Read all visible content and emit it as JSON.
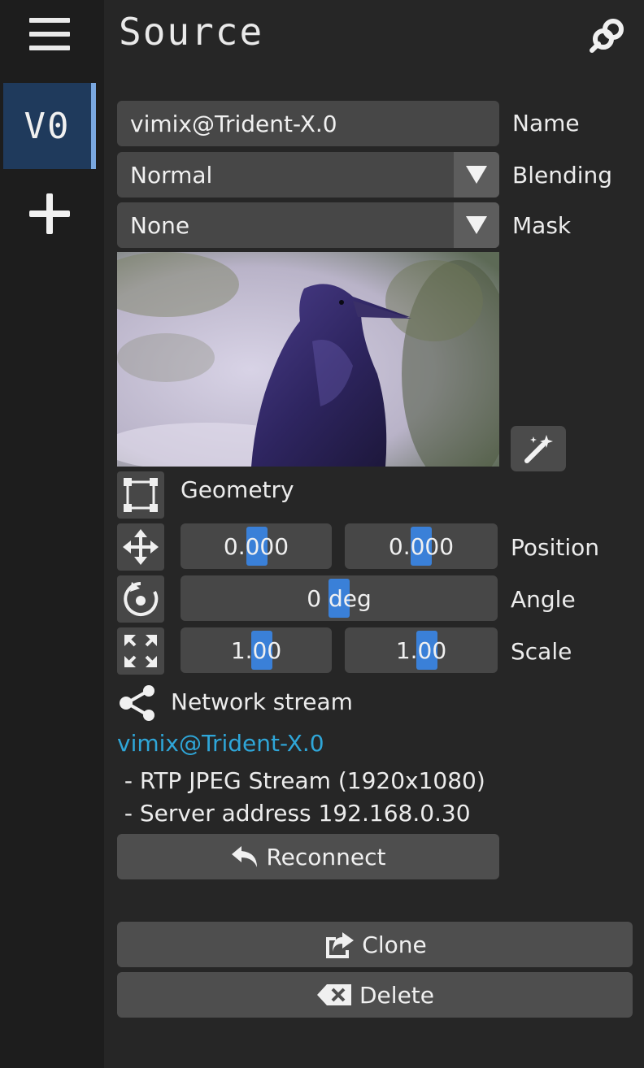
{
  "sidebar": {
    "view_label": "V0"
  },
  "header": {
    "title": "Source"
  },
  "name_field": {
    "value": "vimix@Trident-X.0",
    "label": "Name"
  },
  "blending": {
    "value": "Normal",
    "label": "Blending"
  },
  "mask": {
    "value": "None",
    "label": "Mask"
  },
  "geometry": {
    "label": "Geometry",
    "position": {
      "x": "0.000",
      "y": "0.000",
      "label": "Position"
    },
    "angle": {
      "value": "0 deg",
      "label": "Angle"
    },
    "scale": {
      "x": "1.00",
      "y": "1.00",
      "label": "Scale"
    }
  },
  "stream": {
    "section_label": "Network stream",
    "source_name": "vimix@Trident-X.0",
    "line1": " - RTP JPEG Stream (1920x1080)",
    "line2": " - Server address 192.168.0.30",
    "reconnect_label": "Reconnect"
  },
  "actions": {
    "clone_label": "Clone",
    "delete_label": "Delete"
  },
  "colors": {
    "accent": "#3a80d8",
    "link": "#2fa6d8",
    "background": "#262626",
    "selected": "#1f3a5c"
  },
  "icons": [
    "menu-icon",
    "plus-icon",
    "link-icon",
    "magic-wand-icon",
    "geometry-icon",
    "move-icon",
    "rotate-icon",
    "scale-icon",
    "share-icon",
    "undo-arrow-icon",
    "clone-icon",
    "delete-icon"
  ]
}
